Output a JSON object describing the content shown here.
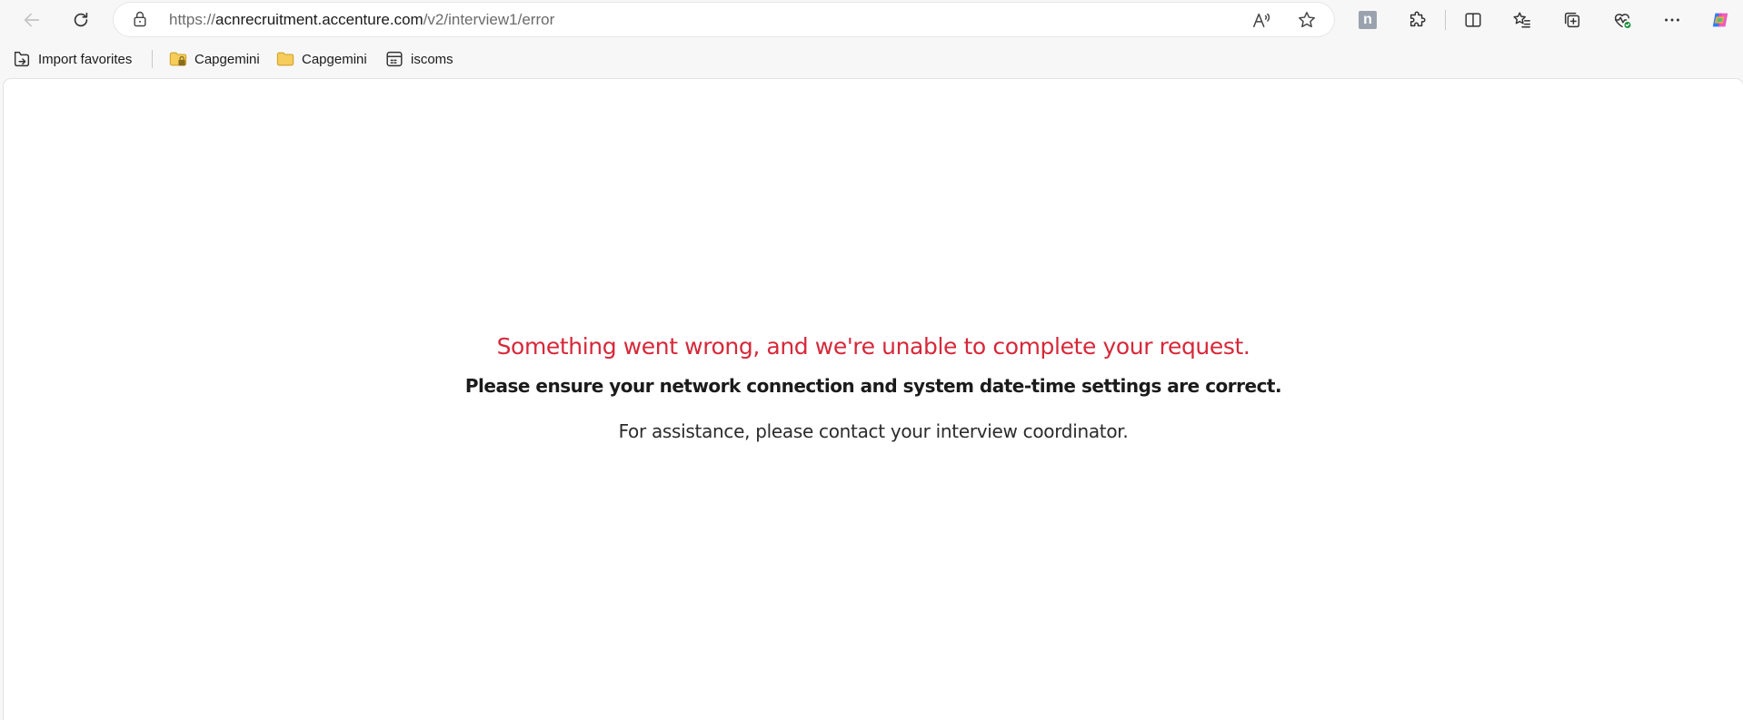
{
  "browser": {
    "url_scheme": "https://",
    "url_host": "acnrecruitment.accenture.com",
    "url_path": "/v2/interview1/error",
    "icons": {
      "back": "back-arrow-icon",
      "refresh": "refresh-icon",
      "lock": "lock-icon",
      "read_aloud": "read-aloud-icon",
      "favorite": "star-icon",
      "extension_n": "n-extension-icon",
      "extensions": "puzzle-icon",
      "split_screen": "split-screen-icon",
      "favorites": "favorites-list-icon",
      "collections": "collections-icon",
      "browser_essentials": "heart-pulse-icon",
      "more": "more-dots-icon",
      "copilot": "copilot-icon"
    },
    "extension_n_label": "n"
  },
  "favorites_bar": {
    "items": [
      {
        "label": "Import favorites",
        "icon": "import-favorites-icon"
      },
      {
        "label": "Capgemini",
        "icon": "folder-locked-icon"
      },
      {
        "label": "Capgemini",
        "icon": "folder-icon"
      },
      {
        "label": "iscoms",
        "icon": "app-icon"
      }
    ]
  },
  "page": {
    "error_title": "Something went wrong, and we're unable to complete your request.",
    "check_message": "Please ensure your network connection and system date-time settings are correct.",
    "help_message": "For assistance, please contact your interview coordinator."
  },
  "colors": {
    "error_red": "#d62839",
    "browser_chrome": "#f7f7f7",
    "page_background": "#ffffff"
  }
}
